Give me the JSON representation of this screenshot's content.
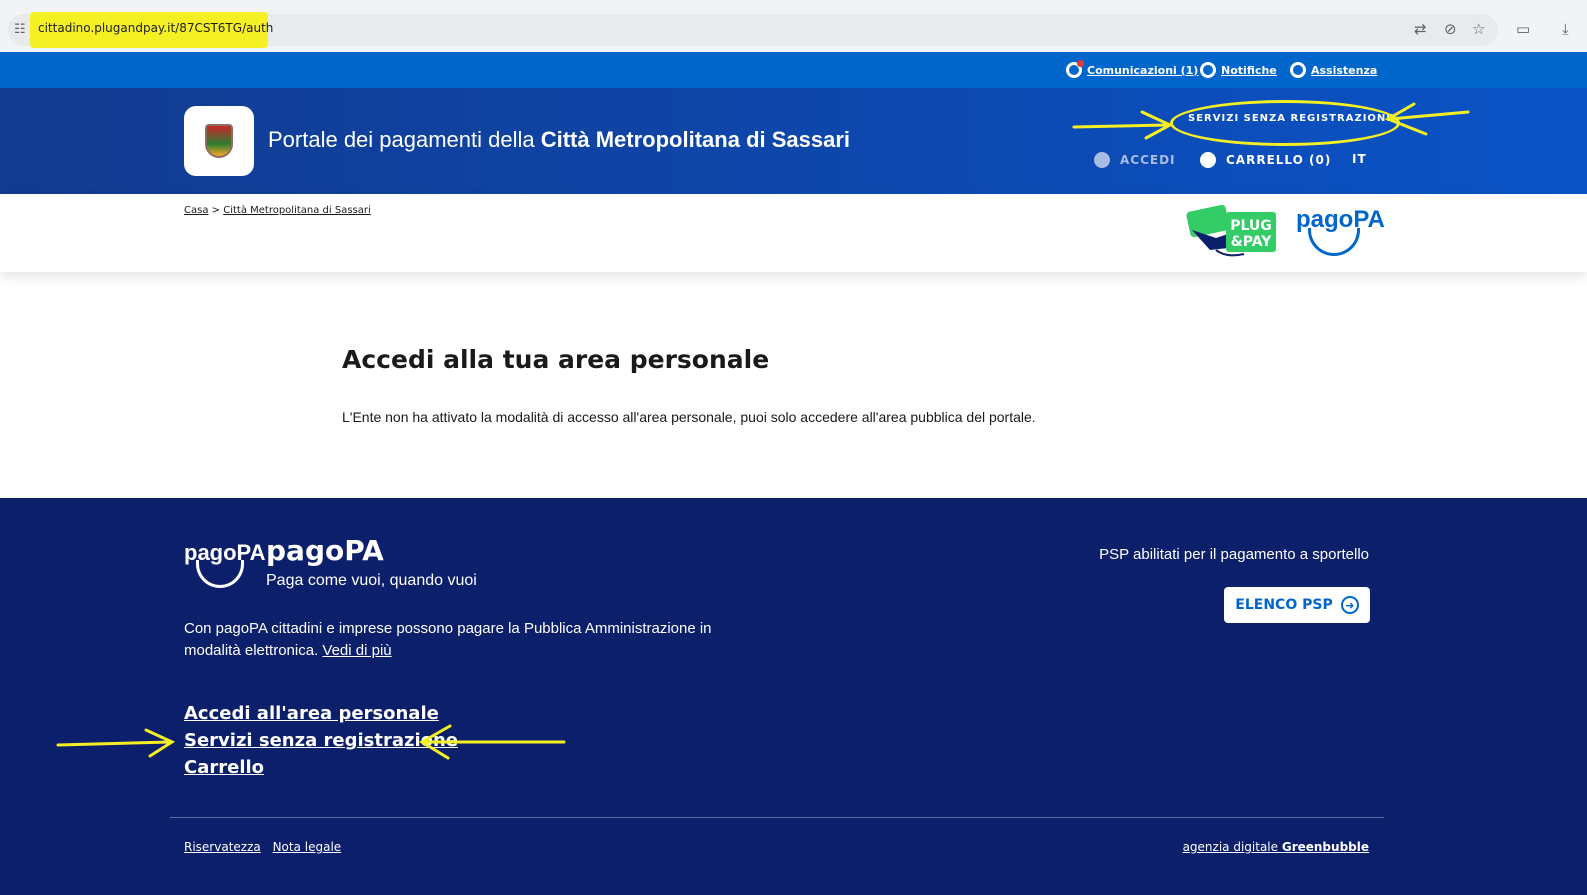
{
  "browser": {
    "url": "cittadino.plugandpay.it/87CST6TG/auth",
    "site_info_icon": "tune-icon",
    "icons": [
      "translate-icon",
      "eye-off-icon",
      "star-icon",
      "extension-icon",
      "download-icon"
    ]
  },
  "util_bar": {
    "comunicazioni": "Comunicazioni (1)",
    "notifiche": "Notifiche",
    "assistenza": "Assistenza"
  },
  "header": {
    "title_prefix": "Portale dei pagamenti della ",
    "title_entity": "Città Metropolitana di Sassari",
    "servizi_link": "SERVIZI SENZA REGISTRAZIONE",
    "accedi": "ACCEDI",
    "carrello": "CARRELLO (0)",
    "lang": "IT"
  },
  "breadcrumb": {
    "home": "Casa",
    "separator": ">",
    "current": "Città Metropolitana di Sassari"
  },
  "logos": {
    "plugpay_line1": "PLUG",
    "plugpay_line2": "&PAY",
    "pagopa": "pagoPA"
  },
  "main": {
    "title": "Accedi alla tua area personale",
    "text": "L'Ente non ha attivato la modalità di accesso all'area personale, puoi solo accedere all'area pubblica del portale."
  },
  "footer": {
    "logo_text": "pagoPA",
    "brand": "pagoPA",
    "tagline": "Paga come vuoi, quando vuoi",
    "description": "Con pagoPA cittadini e imprese possono pagare la Pubblica Amministrazione in modalità elettronica. ",
    "vedi_di_piu": "Vedi di più",
    "links": [
      "Accedi all'area personale",
      "Servizi senza registrazione",
      "Carrello"
    ],
    "psp_label": "PSP abilitati per il pagamento a sportello",
    "psp_button": "ELENCO PSP",
    "riservatezza": "Riservatezza",
    "nota_legale": "Nota legale",
    "agency_prefix": "agenzia digitale ",
    "agency_name": "Greenbubble"
  },
  "colors": {
    "util_bar": "#0066cc",
    "header_dark": "#123a8f",
    "footer": "#0c1f6b",
    "annotation": "#f5f024"
  }
}
